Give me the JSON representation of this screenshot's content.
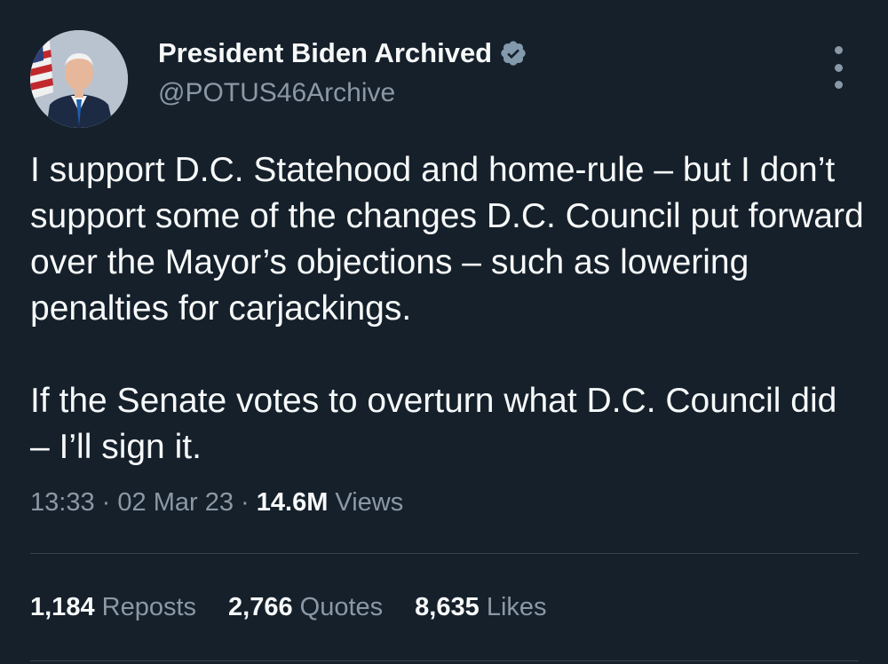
{
  "author": {
    "display_name": "President Biden Archived",
    "handle": "@POTUS46Archive",
    "verified": true,
    "verified_icon": "verified-badge-icon"
  },
  "tweet": {
    "paragraphs": [
      "I support D.C. Statehood and home-rule – but I don’t support some of the changes D.C. Council put forward over the Mayor’s objections – such as lowering penalties for carjackings.",
      "If the Senate votes to overturn what D.C. Council did – I’ll sign it."
    ]
  },
  "meta": {
    "time": "13:33",
    "separator": "·",
    "date": "02 Mar 23",
    "views_count": "14.6M",
    "views_label": "Views"
  },
  "stats": {
    "reposts_count": "1,184",
    "reposts_label": "Reposts",
    "quotes_count": "2,766",
    "quotes_label": "Quotes",
    "likes_count": "8,635",
    "likes_label": "Likes"
  },
  "colors": {
    "background": "#15202b",
    "primary_text": "#f7f9f9",
    "secondary_text": "#8b98a5",
    "divider": "#38444d",
    "verified_badge": "#829aab"
  }
}
